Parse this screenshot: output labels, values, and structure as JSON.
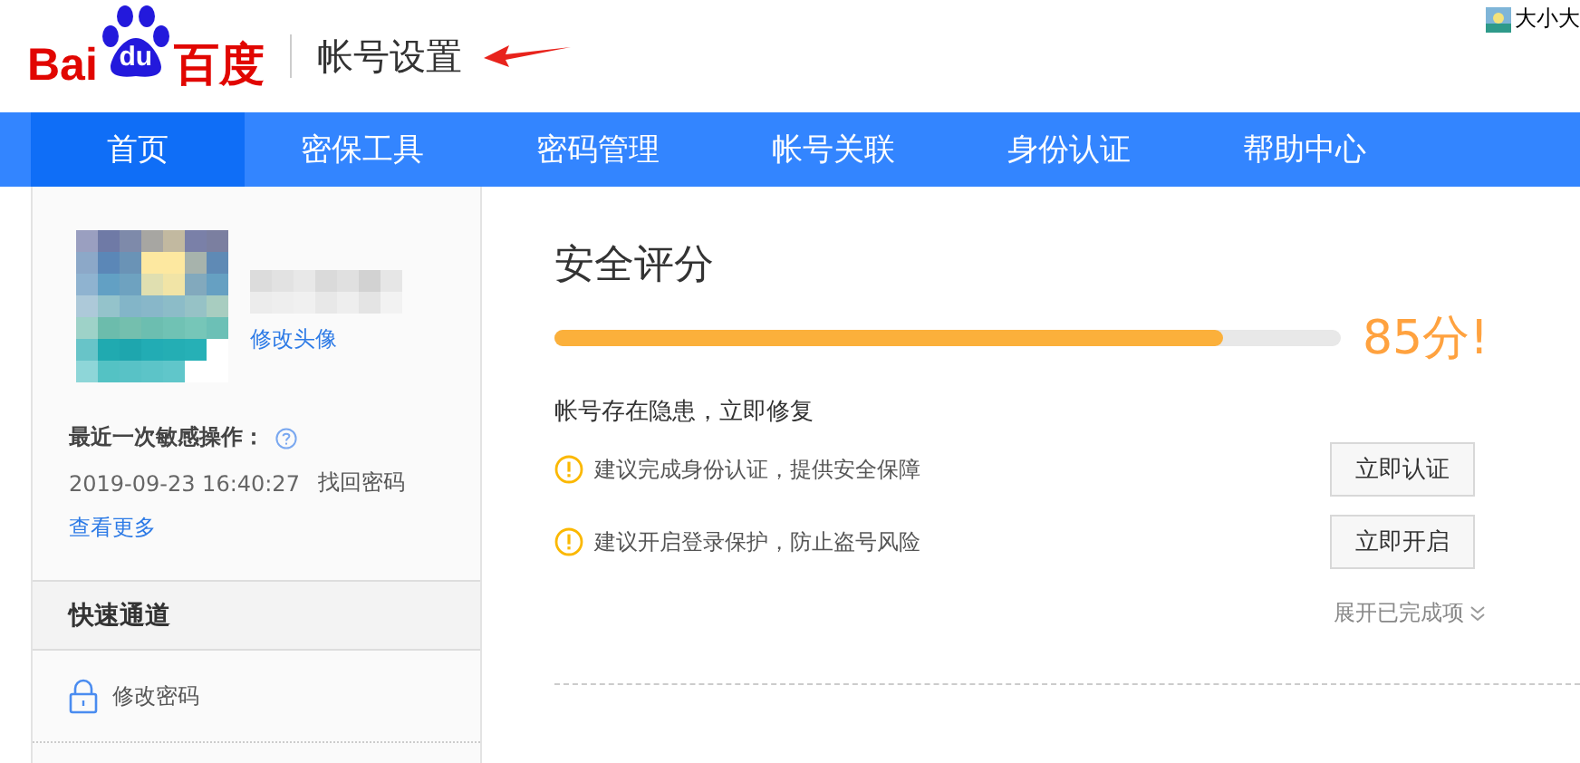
{
  "header": {
    "logo": {
      "left": "Bai",
      "paw": "du",
      "right": "百度"
    },
    "title": "帐号设置",
    "corner_text": "大小大"
  },
  "nav": [
    {
      "label": "首页",
      "selected": true
    },
    {
      "label": "密保工具",
      "selected": false
    },
    {
      "label": "密码管理",
      "selected": false
    },
    {
      "label": "帐号关联",
      "selected": false
    },
    {
      "label": "身份认证",
      "selected": false
    },
    {
      "label": "帮助中心",
      "selected": false
    }
  ],
  "sidebar": {
    "change_avatar": "修改头像",
    "recent_label": "最近一次敏感操作：",
    "recent_time": "2019-09-23 16:40:27",
    "recent_action": "找回密码",
    "more_link": "查看更多",
    "quick_title": "快速通道",
    "quick_items": [
      {
        "label": "修改密码"
      }
    ]
  },
  "score": {
    "title": "安全评分",
    "level": 0.85,
    "reading": "85分!",
    "warning": "帐号存在隐患，立即修复",
    "items": [
      {
        "text": "建议完成身份认证，提供安全保障",
        "button": "立即认证"
      },
      {
        "text": "建议开启登录保护，防止盗号风险",
        "button": "立即开启"
      }
    ],
    "expand_link": "展开已完成项"
  }
}
